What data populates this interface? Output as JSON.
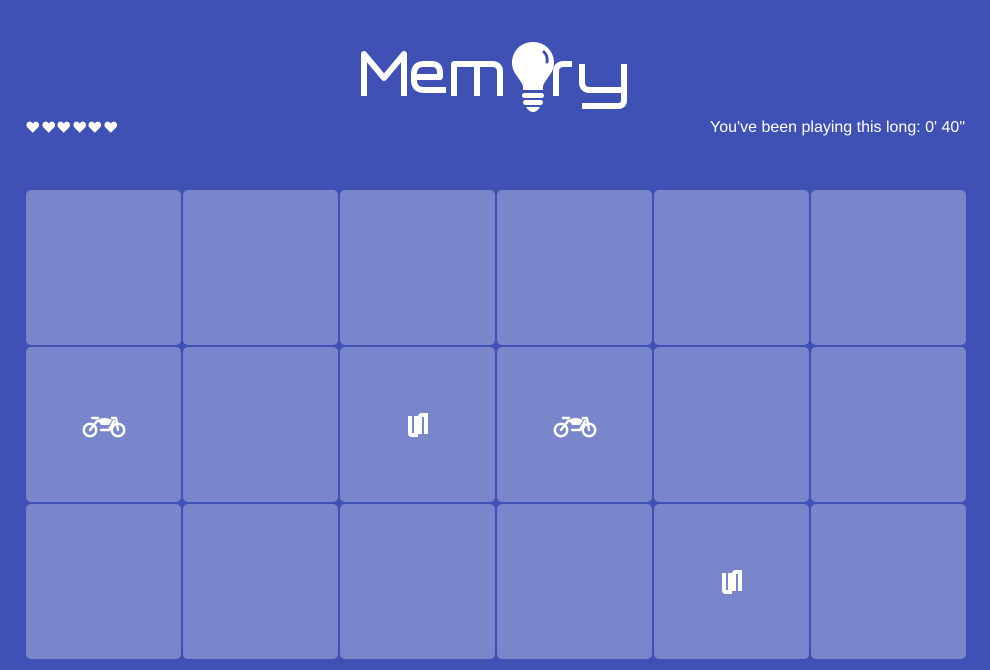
{
  "game": {
    "title": "Memory",
    "lives_total": 6,
    "lives_remaining": 6,
    "timer_label": "You've been playing this long: ",
    "timer_value": "0' 40\""
  },
  "colors": {
    "background": "#3f51b5",
    "card": "#7986cb",
    "foreground": "#ffffff"
  },
  "board": {
    "rows": 3,
    "columns": 6,
    "cards": [
      {
        "state": "closed",
        "symbol": ""
      },
      {
        "state": "closed",
        "symbol": ""
      },
      {
        "state": "closed",
        "symbol": ""
      },
      {
        "state": "closed",
        "symbol": ""
      },
      {
        "state": "closed",
        "symbol": ""
      },
      {
        "state": "closed",
        "symbol": ""
      },
      {
        "state": "open",
        "symbol": "motorcycle-icon"
      },
      {
        "state": "closed",
        "symbol": ""
      },
      {
        "state": "open",
        "symbol": "ui-logo-icon"
      },
      {
        "state": "open",
        "symbol": "motorcycle-icon"
      },
      {
        "state": "closed",
        "symbol": ""
      },
      {
        "state": "closed",
        "symbol": ""
      },
      {
        "state": "closed",
        "symbol": ""
      },
      {
        "state": "closed",
        "symbol": ""
      },
      {
        "state": "closed",
        "symbol": ""
      },
      {
        "state": "closed",
        "symbol": ""
      },
      {
        "state": "open",
        "symbol": "ui-logo-icon"
      },
      {
        "state": "closed",
        "symbol": ""
      }
    ]
  }
}
